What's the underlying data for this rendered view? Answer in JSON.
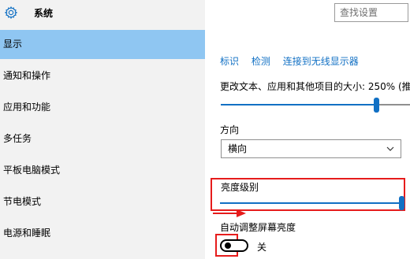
{
  "window": {
    "title": "系统",
    "icon": "gear-icon"
  },
  "search": {
    "placeholder": "查找设置"
  },
  "sidebar": {
    "items": [
      {
        "label": "显示",
        "active": true
      },
      {
        "label": "通知和操作"
      },
      {
        "label": "应用和功能"
      },
      {
        "label": "多任务"
      },
      {
        "label": "平板电脑模式"
      },
      {
        "label": "节电模式"
      },
      {
        "label": "电源和睡眠"
      }
    ]
  },
  "display": {
    "links": [
      "标识",
      "检测",
      "连接到无线显示器"
    ],
    "scale_label": "更改文本、应用和其他项目的大小: 250% (推",
    "scale_value_percent": 81,
    "orientation_label": "方向",
    "orientation_value": "横向",
    "brightness_label": "亮度级别",
    "brightness_value_percent": 99,
    "auto_brightness_label": "自动调整屏幕亮度",
    "auto_brightness_state": "关"
  },
  "colors": {
    "accent": "#1170c4",
    "selected_nav": "#8fc6f2",
    "highlight": "#e61c1c"
  }
}
